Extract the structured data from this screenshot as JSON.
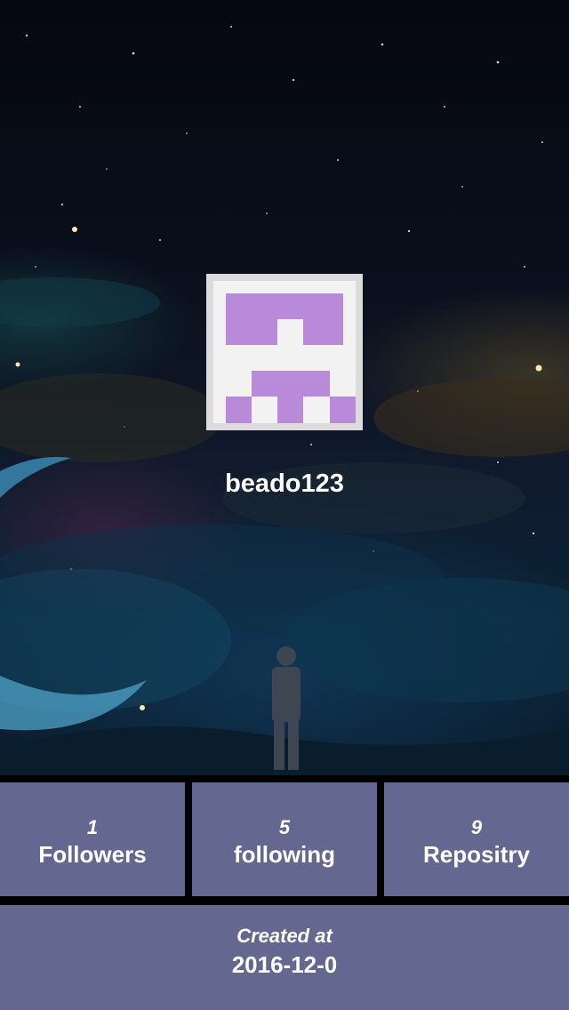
{
  "profile": {
    "username": "beado123",
    "avatar_color": "#b98ad9",
    "background": "night-sky-illustration"
  },
  "stats": {
    "followers": {
      "count": "1",
      "label": "Followers"
    },
    "following": {
      "count": "5",
      "label": "following"
    },
    "repositories": {
      "count": "9",
      "label": "Repositry"
    }
  },
  "created": {
    "label": "Created at",
    "value": "2016-12-0"
  },
  "colors": {
    "tile": "#646790",
    "divider": "#000000",
    "text": "#ffffff"
  }
}
